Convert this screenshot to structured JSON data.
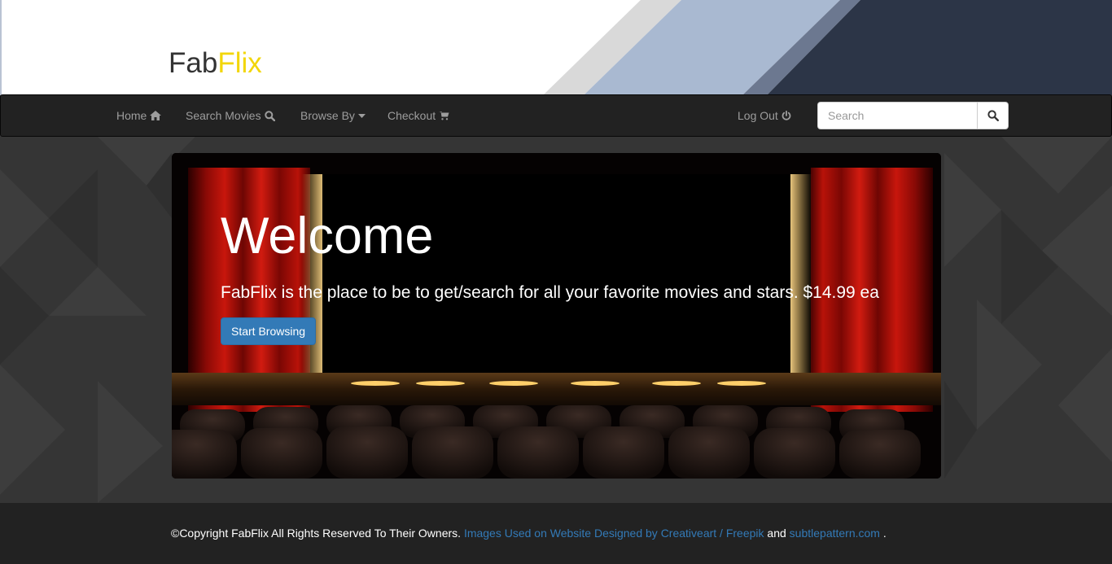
{
  "brand": {
    "part1": "Fab",
    "part2": "Flix"
  },
  "nav": {
    "home": "Home",
    "search_movies": "Search Movies",
    "browse_by": "Browse By",
    "checkout": "Checkout",
    "log_out": "Log Out"
  },
  "search": {
    "placeholder": "Search",
    "value": ""
  },
  "hero": {
    "title": "Welcome",
    "tagline": "FabFlix is the place to be to get/search for all your favorite movies and stars. $14.99 ea",
    "button": "Start Browsing"
  },
  "footer": {
    "copyright": "©Copyright FabFlix All Rights Reserved To Their Owners.",
    "images_link": "Images Used on Website Designed by Creativeart / Freepik",
    "and": "and",
    "pattern_link": "subtlepattern.com",
    "period": "."
  },
  "colors": {
    "brand_accent": "#f2d60a",
    "navbar": "#222222",
    "primary_button": "#337ab7",
    "link": "#337ab7"
  },
  "icons": {
    "home": "home-icon",
    "search_movies": "search-icon",
    "browse_by": "caret-down-icon",
    "checkout": "shopping-cart-icon",
    "log_out": "power-icon",
    "search_button": "search-icon"
  }
}
